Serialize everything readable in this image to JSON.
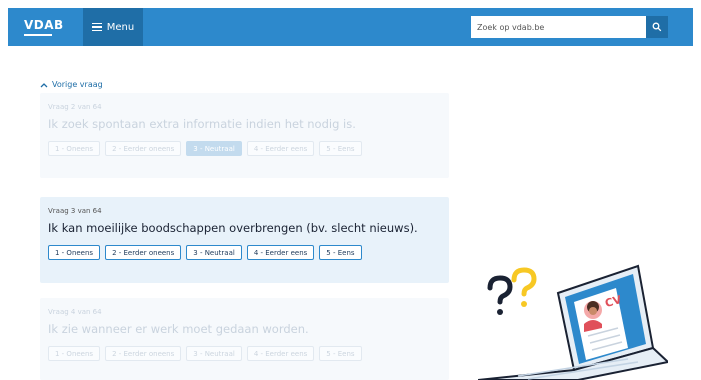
{
  "header": {
    "logo": "VDAB",
    "menu_label": "Menu",
    "search_placeholder": "Zoek op vdab.be"
  },
  "back_link": "Vorige vraag",
  "questions": [
    {
      "counter": "Vraag 2 van 64",
      "text": "Ik zoek spontaan extra informatie indien het nodig is.",
      "state": "faded",
      "selected": 2
    },
    {
      "counter": "Vraag 3 van 64",
      "text": "Ik kan moeilijke boodschappen overbrengen (bv. slecht nieuws).",
      "state": "active",
      "selected": null
    },
    {
      "counter": "Vraag 4 van 64",
      "text": "Ik zie wanneer er werk moet gedaan worden.",
      "state": "faded",
      "selected": null
    }
  ],
  "answers": [
    "1 - Oneens",
    "2 - Eerder oneens",
    "3 - Neutraal",
    "4 - Eerder eens",
    "5 - Eens"
  ],
  "illustration": {
    "cv_label": "CV"
  },
  "colors": {
    "brand": "#2d89cc",
    "brand_dark": "#1f6ea7",
    "accent_yellow": "#f7c824",
    "accent_red": "#e0505a"
  }
}
